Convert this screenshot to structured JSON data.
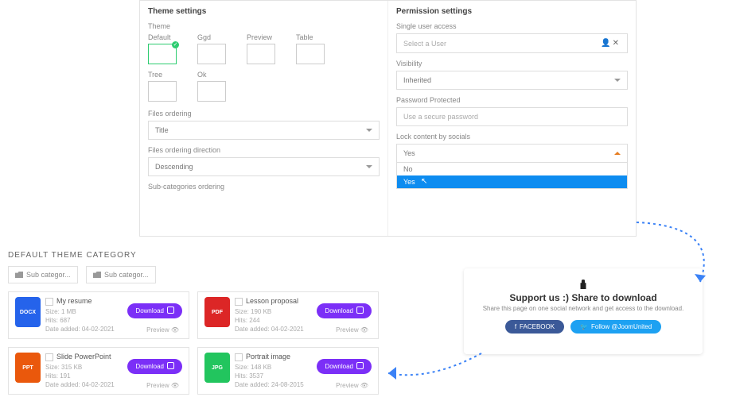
{
  "theme_settings": {
    "title": "Theme settings",
    "theme_label": "Theme",
    "themes_row1": [
      "Default",
      "Ggd",
      "Preview",
      "Table"
    ],
    "themes_row2": [
      "Tree",
      "Ok"
    ],
    "files_ordering_label": "Files ordering",
    "files_ordering_value": "Title",
    "files_ordering_dir_label": "Files ordering direction",
    "files_ordering_dir_value": "Descending",
    "subcat_label": "Sub-categories ordering"
  },
  "permission_settings": {
    "title": "Permission settings",
    "single_user_label": "Single user access",
    "single_user_placeholder": "Select a User",
    "visibility_label": "Visibility",
    "visibility_value": "Inherited",
    "password_label": "Password Protected",
    "password_placeholder": "Use a secure password",
    "lock_label": "Lock content by socials",
    "lock_selected": "Yes",
    "lock_options": [
      "No",
      "Yes"
    ]
  },
  "category": {
    "title": "DEFAULT THEME CATEGORY",
    "folders": [
      "Sub categor...",
      "Sub categor..."
    ],
    "download_label": "Download",
    "preview_label": "Preview",
    "size_label": "Size:",
    "hits_label": "Hits:",
    "date_label": "Date added:",
    "files": [
      {
        "name": "My resume",
        "ext": "DOCX",
        "icon": "ic-docx",
        "size": "1 MB",
        "hits": "687",
        "date": "04-02-2021"
      },
      {
        "name": "Lesson proposal",
        "ext": "PDF",
        "icon": "ic-pdf",
        "size": "190 KB",
        "hits": "244",
        "date": "04-02-2021"
      },
      {
        "name": "Slide PowerPoint",
        "ext": "PPT",
        "icon": "ic-ppt",
        "size": "315 KB",
        "hits": "191",
        "date": "04-02-2021"
      },
      {
        "name": "Portrait image",
        "ext": "JPG",
        "icon": "ic-jpg",
        "size": "148 KB",
        "hits": "3537",
        "date": "24-08-2015"
      }
    ]
  },
  "share_modal": {
    "title": "Support us :) Share to download",
    "subtitle": "Share this page on one social network and get access to the download.",
    "facebook": "FACEBOOK",
    "twitter": "Follow @JoomUnited"
  }
}
